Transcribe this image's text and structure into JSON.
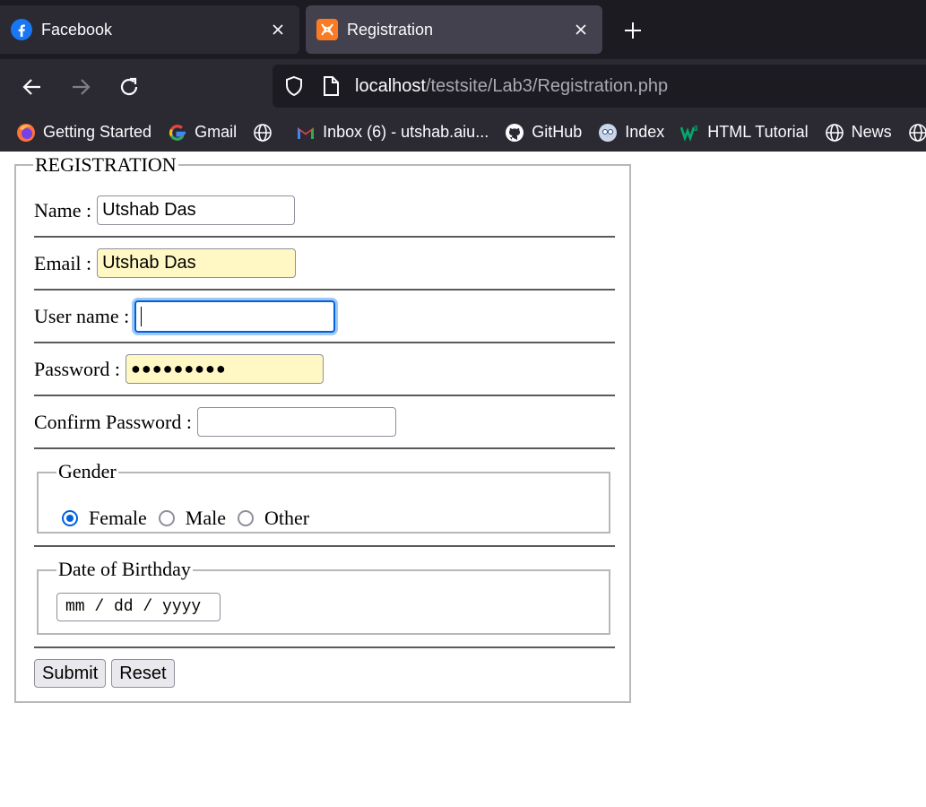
{
  "browser": {
    "tabs": [
      {
        "label": "Facebook"
      },
      {
        "label": "Registration"
      }
    ],
    "url": {
      "host": "localhost",
      "path": "/testsite/Lab3/Registration.php"
    },
    "bookmarks": [
      {
        "label": "Getting Started"
      },
      {
        "label": "Gmail"
      },
      {
        "label": ""
      },
      {
        "label": "Inbox (6) - utshab.aiu..."
      },
      {
        "label": "GitHub"
      },
      {
        "label": "Index"
      },
      {
        "label": "HTML Tutorial"
      },
      {
        "label": "News"
      }
    ]
  },
  "form": {
    "legend": "REGISTRATION",
    "name": {
      "label": "Name :",
      "value": "Utshab Das"
    },
    "email": {
      "label": "Email :",
      "value": "Utshab Das"
    },
    "username": {
      "label": "User name :",
      "value": ""
    },
    "password": {
      "label": "Password :",
      "value": "●●●●●●●●●"
    },
    "confirm": {
      "label": "Confirm Password :",
      "value": ""
    },
    "gender": {
      "legend": "Gender",
      "options": [
        {
          "label": "Female",
          "selected": true
        },
        {
          "label": "Male",
          "selected": false
        },
        {
          "label": "Other",
          "selected": false
        }
      ]
    },
    "dob": {
      "legend": "Date of Birthday",
      "placeholder": "mm / dd / yyyy"
    },
    "buttons": {
      "submit": "Submit",
      "reset": "Reset"
    }
  },
  "colors": {
    "accent": "#0060df",
    "autofill": "#fff8c4",
    "chrome_bg": "#2b2a33"
  }
}
